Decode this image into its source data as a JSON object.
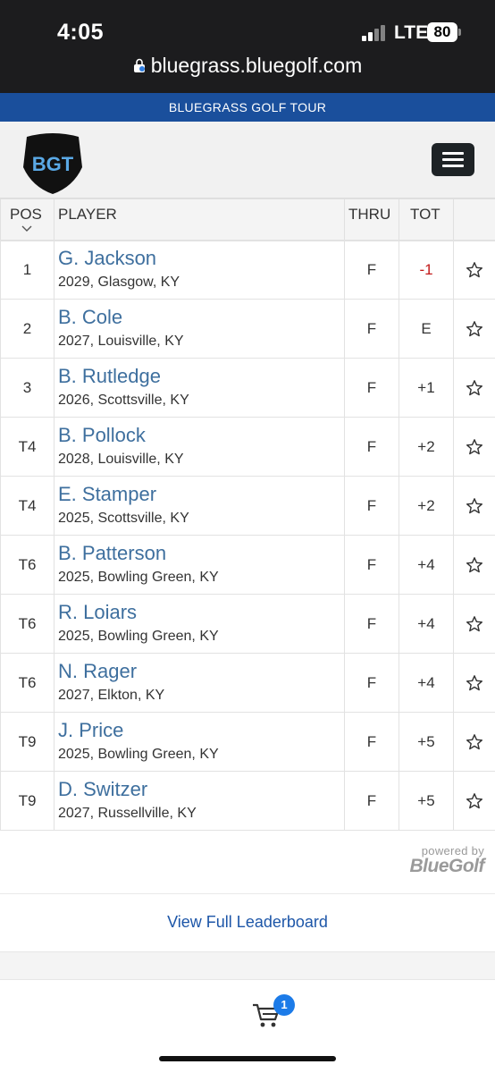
{
  "status_bar": {
    "time": "4:05",
    "network": "LTE",
    "battery": "80",
    "url": "bluegrass.bluegolf.com"
  },
  "tour_bar": {
    "title": "BLUEGRASS GOLF TOUR"
  },
  "header": {
    "logo_text": "BGT",
    "menu_icon": "hamburger-icon"
  },
  "table": {
    "headers": {
      "pos": "POS",
      "player": "PLAYER",
      "thru": "THRU",
      "tot": "TOT"
    },
    "rows": [
      {
        "pos": "1",
        "name": "G. Jackson",
        "info": "2029, Glasgow, KY",
        "thru": "F",
        "tot": "-1"
      },
      {
        "pos": "2",
        "name": "B. Cole",
        "info": "2027, Louisville, KY",
        "thru": "F",
        "tot": "E"
      },
      {
        "pos": "3",
        "name": "B. Rutledge",
        "info": "2026, Scottsville, KY",
        "thru": "F",
        "tot": "+1"
      },
      {
        "pos": "T4",
        "name": "B. Pollock",
        "info": "2028, Louisville, KY",
        "thru": "F",
        "tot": "+2"
      },
      {
        "pos": "T4",
        "name": "E. Stamper",
        "info": "2025, Scottsville, KY",
        "thru": "F",
        "tot": "+2"
      },
      {
        "pos": "T6",
        "name": "B. Patterson",
        "info": "2025, Bowling Green, KY",
        "thru": "F",
        "tot": "+4"
      },
      {
        "pos": "T6",
        "name": "R. Loiars",
        "info": "2025, Bowling Green, KY",
        "thru": "F",
        "tot": "+4"
      },
      {
        "pos": "T6",
        "name": "N. Rager",
        "info": "2027, Elkton, KY",
        "thru": "F",
        "tot": "+4"
      },
      {
        "pos": "T9",
        "name": "J. Price",
        "info": "2025, Bowling Green, KY",
        "thru": "F",
        "tot": "+5"
      },
      {
        "pos": "T9",
        "name": "D. Switzer",
        "info": "2027, Russellville, KY",
        "thru": "F",
        "tot": "+5"
      }
    ]
  },
  "powered_by": {
    "label": "powered by",
    "brand": "BlueGolf"
  },
  "footer": {
    "view_full_label": "View Full Leaderboard",
    "cart_count": "1"
  },
  "colors": {
    "tour_bar": "#1a4f9c",
    "player_link": "#3e6f9e",
    "under_par": "#c21a1a",
    "badge": "#1c7be8"
  }
}
